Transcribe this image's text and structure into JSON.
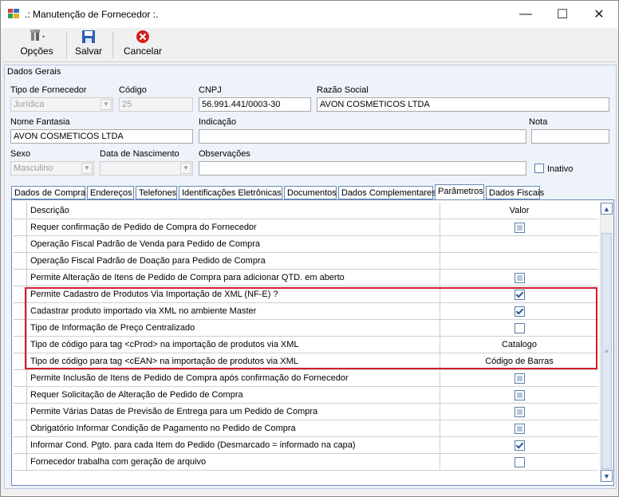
{
  "window": {
    "title": ".: Manutenção de Fornecedor :.",
    "minimize": "—",
    "maximize": "☐",
    "close": "✕"
  },
  "toolbar": {
    "options_label": "Opções",
    "save_label": "Salvar",
    "cancel_label": "Cancelar"
  },
  "group": {
    "title": "Dados Gerais"
  },
  "form": {
    "tipo_fornecedor": {
      "label": "Tipo de Fornecedor",
      "value": "Jurídica"
    },
    "codigo": {
      "label": "Código",
      "value": "25"
    },
    "cnpj": {
      "label": "CNPJ",
      "value": "56.991.441/0003-30"
    },
    "razao_social": {
      "label": "Razão Social",
      "value": "AVON COSMETICOS LTDA"
    },
    "nome_fantasia": {
      "label": "Nome Fantasia",
      "value": "AVON COSMETICOS LTDA"
    },
    "indicacao": {
      "label": "Indicação",
      "value": ""
    },
    "nota": {
      "label": "Nota",
      "value": ""
    },
    "sexo": {
      "label": "Sexo",
      "value": "Masculino"
    },
    "data_nascimento": {
      "label": "Data de Nascimento",
      "value": ""
    },
    "observacoes": {
      "label": "Observações",
      "value": ""
    },
    "inativo": {
      "label": "Inativo",
      "checked": false
    }
  },
  "tabs": [
    {
      "label": "Dados de Compra"
    },
    {
      "label": "Endereços"
    },
    {
      "label": "Telefones"
    },
    {
      "label": "Identificações Eletrônicas"
    },
    {
      "label": "Documentos"
    },
    {
      "label": "Dados Complementares"
    },
    {
      "label": "Parâmetros"
    },
    {
      "label": "Dados Fiscais"
    }
  ],
  "active_tab": "Parâmetros",
  "grid": {
    "columns": {
      "descricao": "Descrição",
      "valor": "Valor"
    },
    "rows": [
      {
        "descricao": "Requer confirmação de Pedido de Compra do Fornecedor",
        "valor": "",
        "check": "disabled"
      },
      {
        "descricao": "Operação Fiscal Padrão de Venda para Pedido de Compra",
        "valor": "",
        "check": "none"
      },
      {
        "descricao": "Operação Fiscal Padrão de Doação para Pedido de Compra",
        "valor": "",
        "check": "none"
      },
      {
        "descricao": "Permite Alteração de Itens de Pedido de Compra para adicionar QTD. em aberto",
        "valor": "",
        "check": "disabled"
      },
      {
        "descricao": "Permite Cadastro de Produtos Via Importação de XML (NF-E) ?",
        "valor": "",
        "check": "checked"
      },
      {
        "descricao": "Cadastrar produto importado via XML no ambiente Master",
        "valor": "",
        "check": "checked"
      },
      {
        "descricao": "Tipo de Informação de Preço Centralizado",
        "valor": "",
        "check": "unchecked"
      },
      {
        "descricao": "Tipo de código para tag <cProd> na importação de produtos via XML",
        "valor": "Catalogo",
        "check": "none"
      },
      {
        "descricao": "Tipo de código para tag <cEAN> na importação de produtos via XML",
        "valor": "Código de Barras",
        "check": "none"
      },
      {
        "descricao": "Permite Inclusão de Itens de Pedido de Compra após confirmação do Fornecedor",
        "valor": "",
        "check": "disabled"
      },
      {
        "descricao": "Requer Solicitação de Alteração de Pedido de Compra",
        "valor": "",
        "check": "disabled"
      },
      {
        "descricao": "Permite Várias Datas de Previsão de Entrega para um Pedido de Compra",
        "valor": "",
        "check": "disabled"
      },
      {
        "descricao": "Obrigatório Informar Condição de Pagamento no Pedido de Compra",
        "valor": "",
        "check": "disabled"
      },
      {
        "descricao": "Informar Cond. Pgto. para cada Item do Pedido (Desmarcado = informado na capa)",
        "valor": "",
        "check": "checked"
      },
      {
        "descricao": "Fornecedor trabalha com geração de arquivo",
        "valor": "",
        "check": "unchecked"
      }
    ]
  },
  "colors": {
    "highlight_border": "#d0202a",
    "accent": "#2b5797"
  }
}
